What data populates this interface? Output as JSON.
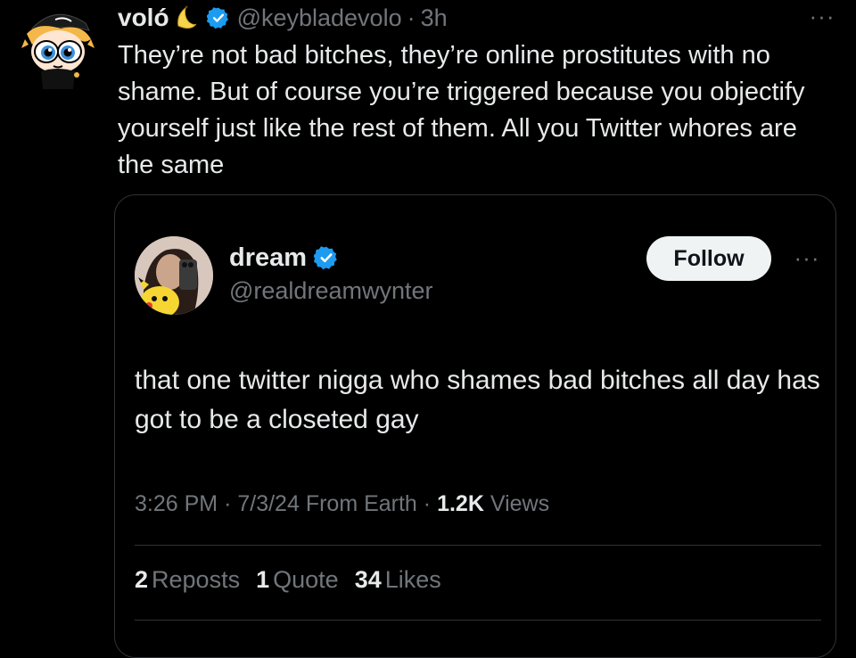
{
  "reply": {
    "author_name": "voló",
    "author_handle": "@keybladevolo",
    "separator": "·",
    "time": "3h",
    "more": "···",
    "text": "They’re not bad bitches, they’re online prostitutes with no shame. But of course you’re triggered because you objectify yourself just like the rest of them. All you Twitter whores are the same",
    "icons": {
      "avatar": "cartoon-avatar-icon",
      "banana": "banana-emoji-icon",
      "verified": "verified-badge-icon"
    }
  },
  "quote": {
    "author_name": "dream",
    "author_handle": "@realdreamwynter",
    "follow_label": "Follow",
    "more": "···",
    "text": "that one twitter nigga who shames bad bitches all day has got to be a closeted gay",
    "meta": {
      "time": "3:26 PM",
      "date": "7/3/24",
      "location": "From Earth",
      "views_count": "1.2K",
      "views_label": "Views",
      "separator": "·"
    },
    "stats": [
      {
        "count": "2",
        "label": "Reposts"
      },
      {
        "count": "1",
        "label": "Quote"
      },
      {
        "count": "34",
        "label": "Likes"
      }
    ]
  },
  "colors": {
    "background": "#000000",
    "text_primary": "#e7e9ea",
    "text_secondary": "#71767b",
    "verified_blue": "#1d9bf0",
    "border": "#2f3336",
    "follow_bg": "#eff3f4"
  }
}
